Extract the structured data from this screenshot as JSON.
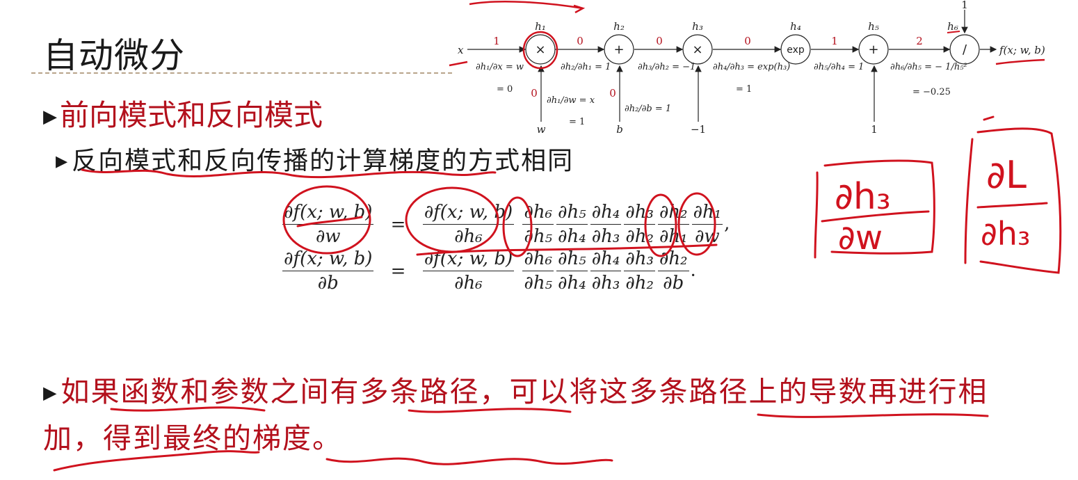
{
  "slide": {
    "title": "自动微分",
    "bullet1": "前向模式和反向模式",
    "bullet2": "反向模式和反向传播的计算梯度的方式相同",
    "bullet3": "如果函数和参数之间有多条路径，可以将这多条路径上的导数再进行相加，得到最终的梯度。"
  },
  "graph": {
    "input_x": "x",
    "output": "f(x; w, b)",
    "nodes": [
      {
        "label": "h₁",
        "op": "×"
      },
      {
        "label": "h₂",
        "op": "+"
      },
      {
        "label": "h₃",
        "op": "×"
      },
      {
        "label": "h₄",
        "op": "exp"
      },
      {
        "label": "h₅",
        "op": "+"
      },
      {
        "label": "h₆",
        "op": "/"
      }
    ],
    "edge_values": [
      "1",
      "0",
      "0",
      "0",
      "1",
      "2"
    ],
    "side_inputs": {
      "w": "w",
      "w_val": "0",
      "b": "b",
      "b_val": "0",
      "h3_in": "−1",
      "h5_in": "1",
      "h6_in": "1"
    },
    "derivatives": {
      "d1_lhs": "∂h₁/∂x = w",
      "d1_val": "= 0",
      "d2": "∂h₂/∂h₁ = 1",
      "d3": "∂h₃/∂h₂ = −1",
      "d4_lhs": "∂h₄/∂h₃ = exp(h₃)",
      "d4_val": "= 1",
      "d5": "∂h₅/∂h₄ = 1",
      "d6_lhs": "∂h₆/∂h₅ = − 1/h₅²",
      "d6_val": "= −0.25",
      "dw_lhs": "∂h₁/∂w = x",
      "dw_val": "= 1",
      "db": "∂h₂/∂b = 1"
    }
  },
  "equations": {
    "eq1": {
      "lhs_num": "∂f(x; w, b)",
      "lhs_den": "∂w",
      "eq": "=",
      "f_num": "∂f(x; w, b)",
      "f_den": "∂h₆",
      "chain": [
        {
          "n": "∂h₆",
          "d": "∂h₅"
        },
        {
          "n": "∂h₅",
          "d": "∂h₄"
        },
        {
          "n": "∂h₄",
          "d": "∂h₃"
        },
        {
          "n": "∂h₃",
          "d": "∂h₂"
        },
        {
          "n": "∂h₂",
          "d": "∂h₁"
        },
        {
          "n": "∂h₁",
          "d": "∂w"
        }
      ],
      "end": ","
    },
    "eq2": {
      "lhs_num": "∂f(x; w, b)",
      "lhs_den": "∂b",
      "eq": "=",
      "f_num": "∂f(x; w, b)",
      "f_den": "∂h₆",
      "chain": [
        {
          "n": "∂h₆",
          "d": "∂h₅"
        },
        {
          "n": "∂h₅",
          "d": "∂h₄"
        },
        {
          "n": "∂h₄",
          "d": "∂h₃"
        },
        {
          "n": "∂h₃",
          "d": "∂h₂"
        },
        {
          "n": "∂h₂",
          "d": "∂b"
        }
      ],
      "end": "."
    }
  },
  "handwriting": {
    "box1_num": "∂h₃",
    "box1_den": "∂w",
    "box2_num": "∂L",
    "box2_den": "∂h₃",
    "ink_color": "#d0121e"
  }
}
